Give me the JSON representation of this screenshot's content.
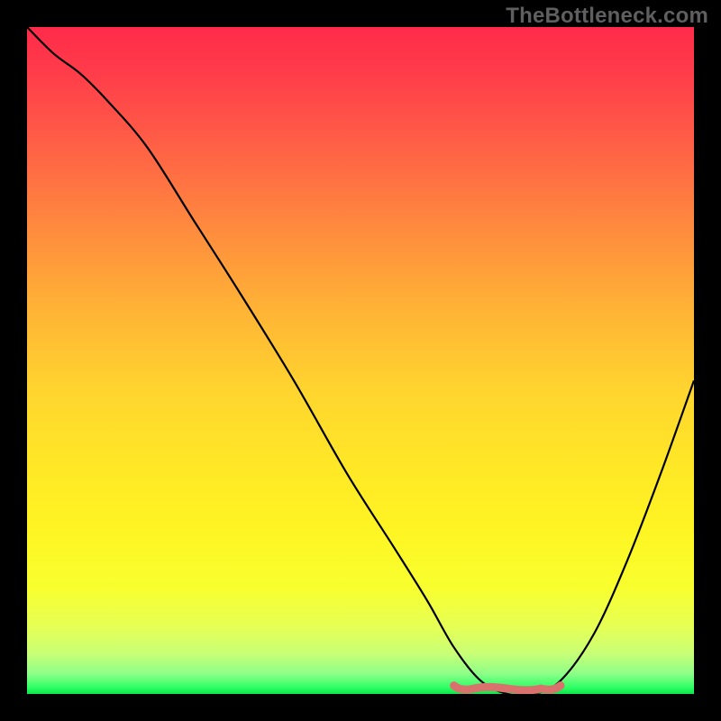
{
  "attribution": "TheBottleneck.com",
  "chart_data": {
    "type": "line",
    "title": "",
    "xlabel": "",
    "ylabel": "",
    "xlim": [
      0,
      100
    ],
    "ylim": [
      0,
      100
    ],
    "grid": false,
    "legend": false,
    "series": [
      {
        "name": "bottleneck-curve",
        "color": "#000000",
        "x": [
          0,
          4,
          8,
          12,
          18,
          25,
          32,
          40,
          48,
          55,
          60,
          64,
          68,
          72,
          76,
          80,
          85,
          90,
          95,
          100
        ],
        "y": [
          100,
          96,
          93,
          89,
          82,
          71,
          60,
          47,
          33,
          22,
          14,
          7,
          2,
          0,
          0,
          2,
          9,
          20,
          33,
          47
        ]
      }
    ],
    "optimal_marker": {
      "color": "#d9716d",
      "x_start": 64,
      "x_end": 80,
      "y": 0.8
    },
    "background_gradient": {
      "top": "#ff2a4a",
      "bottom": "#0be64a",
      "meaning": "red_high_bottleneck_to_green_no_bottleneck"
    }
  }
}
